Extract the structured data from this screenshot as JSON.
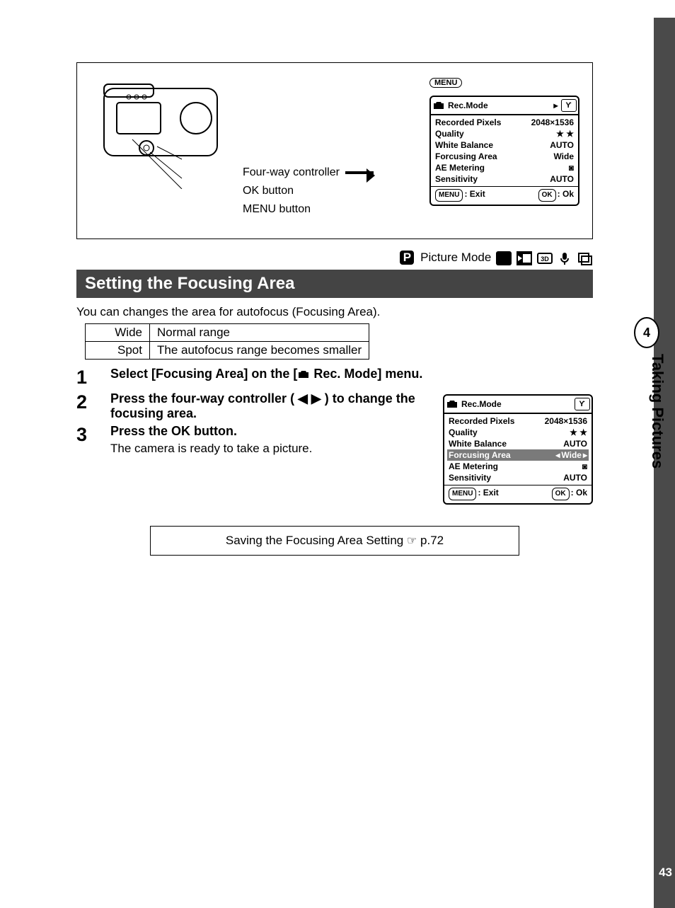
{
  "tab": {
    "number": "4",
    "label": "Taking Pictures"
  },
  "page_number": "43",
  "diagram": {
    "labels": [
      "Four-way controller",
      "OK button",
      "MENU button"
    ],
    "menu_badge": "MENU"
  },
  "lcd1": {
    "title": "Rec.Mode",
    "rows": [
      {
        "k": "Recorded Pixels",
        "v": "2048×1536"
      },
      {
        "k": "Quality",
        "v": "★ ★"
      },
      {
        "k": "White Balance",
        "v": "AUTO"
      },
      {
        "k": "Forcusing Area",
        "v": "Wide"
      },
      {
        "k": "AE Metering",
        "v": "◙"
      },
      {
        "k": "Sensitivity",
        "v": "AUTO"
      }
    ],
    "foot": {
      "menu_pill": "MENU",
      "exit": ": Exit",
      "ok_pill": "OK",
      "ok": ": Ok"
    }
  },
  "lcd2": {
    "title": "Rec.Mode",
    "rows": [
      {
        "k": "Recorded Pixels",
        "v": "2048×1536"
      },
      {
        "k": "Quality",
        "v": "★ ★"
      },
      {
        "k": "White Balance",
        "v": "AUTO"
      },
      {
        "k": "Forcusing Area",
        "v": "Wide"
      },
      {
        "k": "AE Metering",
        "v": "◙"
      },
      {
        "k": "Sensitivity",
        "v": "AUTO"
      }
    ],
    "foot": {
      "menu_pill": "MENU",
      "exit": ": Exit",
      "ok_pill": "OK",
      "ok": ": Ok"
    }
  },
  "mode": {
    "p": "P",
    "label": "Picture Mode"
  },
  "heading": "Setting the Focusing Area",
  "intro": "You can changes the area for autofocus (Focusing Area).",
  "table": [
    {
      "k": "Wide",
      "v": "Normal range"
    },
    {
      "k": "Spot",
      "v": "The autofocus range becomes smaller"
    }
  ],
  "steps": [
    {
      "n": "1",
      "pre": "Select [Focusing Area] on the [",
      "post": "Rec. Mode] menu."
    },
    {
      "n": "2",
      "t": "Press the four-way controller ( ◀ ▶ ) to change the focusing area."
    },
    {
      "n": "3",
      "t": "Press the OK button.",
      "sub": "The camera is ready to take a picture."
    }
  ],
  "ref": {
    "text": "Saving the Focusing Area Setting ",
    "page": " p.72"
  }
}
